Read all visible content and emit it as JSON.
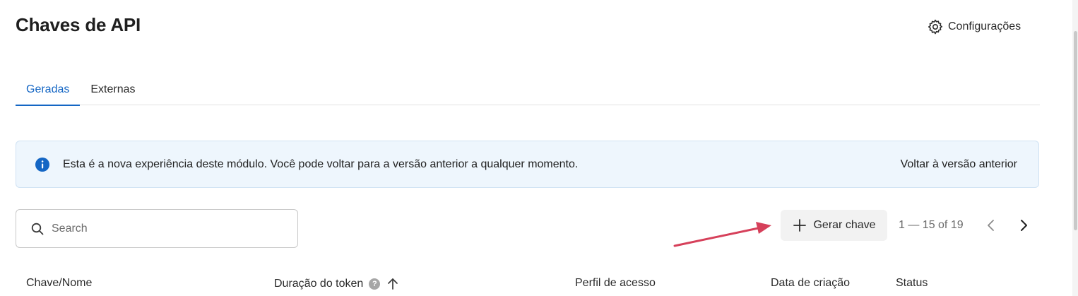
{
  "header": {
    "title": "Chaves de API",
    "settings_label": "Configurações",
    "settings_icon": "gear-icon"
  },
  "tabs": [
    {
      "label": "Geradas",
      "active": true
    },
    {
      "label": "Externas",
      "active": false
    }
  ],
  "banner": {
    "icon": "info-icon",
    "message": "Esta é a nova experiência deste módulo. Você pode voltar para a versão anterior a qualquer momento.",
    "link_label": "Voltar à versão anterior"
  },
  "search": {
    "placeholder": "Search",
    "value": ""
  },
  "toolbar": {
    "generate_label": "Gerar chave",
    "pagination": "1 — 15 of 19"
  },
  "table": {
    "columns": [
      "Chave/Nome",
      "Duração do token",
      "Perfil de acesso",
      "Data de criação",
      "Status"
    ],
    "help_badge": "?"
  },
  "colors": {
    "accent": "#1466c4",
    "banner_bg": "#eef6fd",
    "annotation_arrow": "#d6405a"
  }
}
